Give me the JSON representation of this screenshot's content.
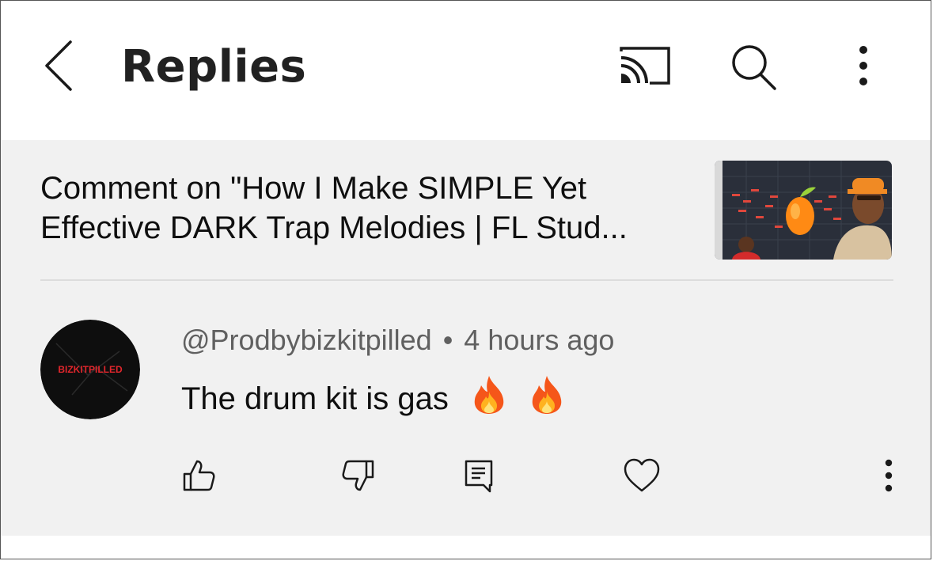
{
  "header": {
    "title": "Replies",
    "icons": {
      "back": "chevron-left-icon",
      "cast": "cast-icon",
      "search": "search-icon",
      "more": "more-vertical-icon"
    }
  },
  "video": {
    "title_line1": "Comment on \"How I Make SIMPLE Yet",
    "title_line2": "Effective DARK Trap Melodies | FL Stud..."
  },
  "comment": {
    "author": "@Prodbybizkitpilled",
    "separator": "•",
    "time": "4 hours ago",
    "text": "The drum kit is gas",
    "emoji": [
      "fire-icon",
      "fire-icon"
    ],
    "avatar_text": "BIZKITPILLED"
  },
  "actions": {
    "like": "thumbs-up-icon",
    "dislike": "thumbs-down-icon",
    "reply": "comment-icon",
    "heart": "heart-icon",
    "more": "more-vertical-icon"
  },
  "colors": {
    "panel_bg": "#f1f1f1",
    "text_primary": "#0f0f0f",
    "text_secondary": "#606060",
    "avatar_accent": "#e0262c",
    "thumb_accent": "#ff8a14"
  }
}
